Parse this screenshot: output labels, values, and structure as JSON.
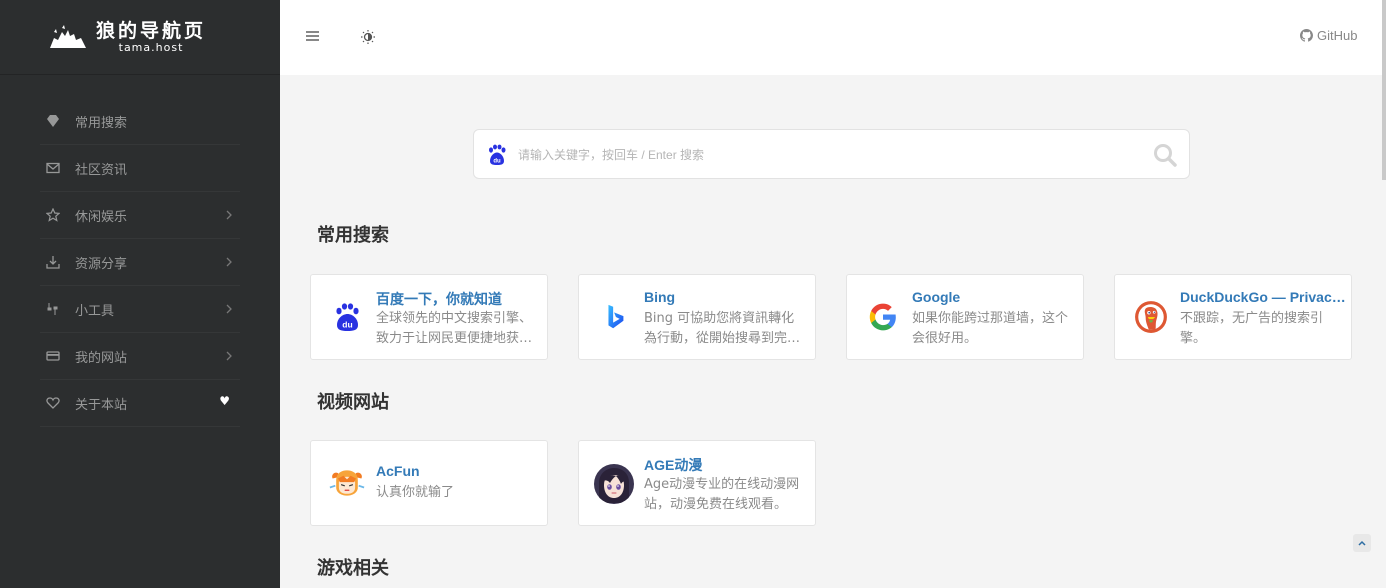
{
  "brand": {
    "title": "狼的导航页",
    "subtitle": "tama.host"
  },
  "sidebar": {
    "items": [
      {
        "label": "常用搜索",
        "icon": "diamond-icon",
        "has_arrow": false
      },
      {
        "label": "社区资讯",
        "icon": "envelope-icon",
        "has_arrow": false
      },
      {
        "label": "休闲娱乐",
        "icon": "star-icon",
        "has_arrow": true
      },
      {
        "label": "资源分享",
        "icon": "download-icon",
        "has_arrow": true
      },
      {
        "label": "小工具",
        "icon": "tools-icon",
        "has_arrow": true
      },
      {
        "label": "我的网站",
        "icon": "credit-card-icon",
        "has_arrow": true
      },
      {
        "label": "关于本站",
        "icon": "heart-outline-icon",
        "has_arrow": false,
        "badge": "♥"
      }
    ]
  },
  "topbar": {
    "github_label": "GitHub"
  },
  "search": {
    "placeholder": "请输入关键字，按回车 / Enter 搜索",
    "engine_icon": "baidu-paw-icon"
  },
  "sections": [
    {
      "title": "常用搜索",
      "cards": [
        {
          "title": "百度一下，你就知道",
          "desc": "全球领先的中文搜索引擎、致力于让网民更便捷地获取信息，找到所求。",
          "icon": "baidu-icon"
        },
        {
          "title": "Bing",
          "desc": "Bing 可協助您將資訊轉化為行動，從開始搜尋到完成。",
          "icon": "bing-icon"
        },
        {
          "title": "Google",
          "desc": "如果你能跨过那道墙，这个会很好用。",
          "icon": "google-icon"
        },
        {
          "title": "DuckDuckGo — Privacy, simplified.",
          "desc": "不跟踪，无广告的搜索引擎。",
          "icon": "duckduckgo-icon"
        }
      ]
    },
    {
      "title": "视频网站",
      "cards": [
        {
          "title": "AcFun",
          "desc": "认真你就输了",
          "icon": "acfun-icon"
        },
        {
          "title": "AGE动漫",
          "desc": "Age动漫专业的在线动漫网站，动漫免费在线观看。",
          "icon": "age-icon"
        }
      ]
    },
    {
      "title": "游戏相关",
      "cards": []
    }
  ]
}
